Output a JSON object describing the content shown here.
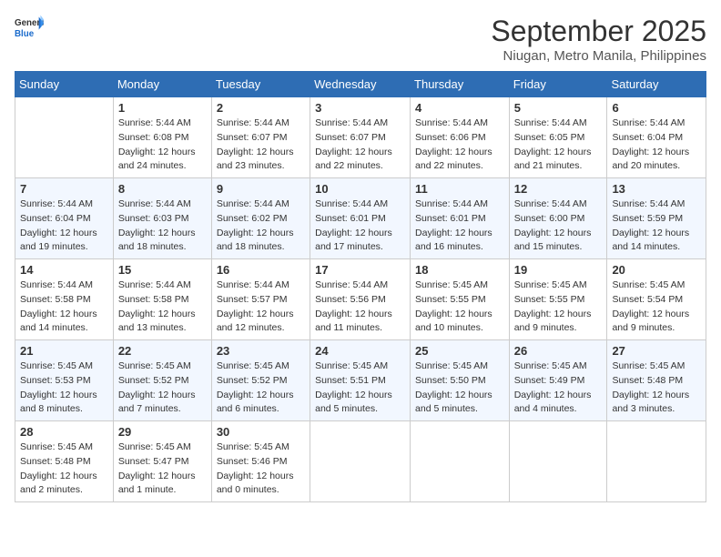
{
  "header": {
    "logo_general": "General",
    "logo_blue": "Blue",
    "month": "September 2025",
    "location": "Niugan, Metro Manila, Philippines"
  },
  "days_of_week": [
    "Sunday",
    "Monday",
    "Tuesday",
    "Wednesday",
    "Thursday",
    "Friday",
    "Saturday"
  ],
  "weeks": [
    [
      {
        "day": "",
        "sunrise": "",
        "sunset": "",
        "daylight": ""
      },
      {
        "day": "1",
        "sunrise": "Sunrise: 5:44 AM",
        "sunset": "Sunset: 6:08 PM",
        "daylight": "Daylight: 12 hours and 24 minutes."
      },
      {
        "day": "2",
        "sunrise": "Sunrise: 5:44 AM",
        "sunset": "Sunset: 6:07 PM",
        "daylight": "Daylight: 12 hours and 23 minutes."
      },
      {
        "day": "3",
        "sunrise": "Sunrise: 5:44 AM",
        "sunset": "Sunset: 6:07 PM",
        "daylight": "Daylight: 12 hours and 22 minutes."
      },
      {
        "day": "4",
        "sunrise": "Sunrise: 5:44 AM",
        "sunset": "Sunset: 6:06 PM",
        "daylight": "Daylight: 12 hours and 22 minutes."
      },
      {
        "day": "5",
        "sunrise": "Sunrise: 5:44 AM",
        "sunset": "Sunset: 6:05 PM",
        "daylight": "Daylight: 12 hours and 21 minutes."
      },
      {
        "day": "6",
        "sunrise": "Sunrise: 5:44 AM",
        "sunset": "Sunset: 6:04 PM",
        "daylight": "Daylight: 12 hours and 20 minutes."
      }
    ],
    [
      {
        "day": "7",
        "sunrise": "Sunrise: 5:44 AM",
        "sunset": "Sunset: 6:04 PM",
        "daylight": "Daylight: 12 hours and 19 minutes."
      },
      {
        "day": "8",
        "sunrise": "Sunrise: 5:44 AM",
        "sunset": "Sunset: 6:03 PM",
        "daylight": "Daylight: 12 hours and 18 minutes."
      },
      {
        "day": "9",
        "sunrise": "Sunrise: 5:44 AM",
        "sunset": "Sunset: 6:02 PM",
        "daylight": "Daylight: 12 hours and 18 minutes."
      },
      {
        "day": "10",
        "sunrise": "Sunrise: 5:44 AM",
        "sunset": "Sunset: 6:01 PM",
        "daylight": "Daylight: 12 hours and 17 minutes."
      },
      {
        "day": "11",
        "sunrise": "Sunrise: 5:44 AM",
        "sunset": "Sunset: 6:01 PM",
        "daylight": "Daylight: 12 hours and 16 minutes."
      },
      {
        "day": "12",
        "sunrise": "Sunrise: 5:44 AM",
        "sunset": "Sunset: 6:00 PM",
        "daylight": "Daylight: 12 hours and 15 minutes."
      },
      {
        "day": "13",
        "sunrise": "Sunrise: 5:44 AM",
        "sunset": "Sunset: 5:59 PM",
        "daylight": "Daylight: 12 hours and 14 minutes."
      }
    ],
    [
      {
        "day": "14",
        "sunrise": "Sunrise: 5:44 AM",
        "sunset": "Sunset: 5:58 PM",
        "daylight": "Daylight: 12 hours and 14 minutes."
      },
      {
        "day": "15",
        "sunrise": "Sunrise: 5:44 AM",
        "sunset": "Sunset: 5:58 PM",
        "daylight": "Daylight: 12 hours and 13 minutes."
      },
      {
        "day": "16",
        "sunrise": "Sunrise: 5:44 AM",
        "sunset": "Sunset: 5:57 PM",
        "daylight": "Daylight: 12 hours and 12 minutes."
      },
      {
        "day": "17",
        "sunrise": "Sunrise: 5:44 AM",
        "sunset": "Sunset: 5:56 PM",
        "daylight": "Daylight: 12 hours and 11 minutes."
      },
      {
        "day": "18",
        "sunrise": "Sunrise: 5:45 AM",
        "sunset": "Sunset: 5:55 PM",
        "daylight": "Daylight: 12 hours and 10 minutes."
      },
      {
        "day": "19",
        "sunrise": "Sunrise: 5:45 AM",
        "sunset": "Sunset: 5:55 PM",
        "daylight": "Daylight: 12 hours and 9 minutes."
      },
      {
        "day": "20",
        "sunrise": "Sunrise: 5:45 AM",
        "sunset": "Sunset: 5:54 PM",
        "daylight": "Daylight: 12 hours and 9 minutes."
      }
    ],
    [
      {
        "day": "21",
        "sunrise": "Sunrise: 5:45 AM",
        "sunset": "Sunset: 5:53 PM",
        "daylight": "Daylight: 12 hours and 8 minutes."
      },
      {
        "day": "22",
        "sunrise": "Sunrise: 5:45 AM",
        "sunset": "Sunset: 5:52 PM",
        "daylight": "Daylight: 12 hours and 7 minutes."
      },
      {
        "day": "23",
        "sunrise": "Sunrise: 5:45 AM",
        "sunset": "Sunset: 5:52 PM",
        "daylight": "Daylight: 12 hours and 6 minutes."
      },
      {
        "day": "24",
        "sunrise": "Sunrise: 5:45 AM",
        "sunset": "Sunset: 5:51 PM",
        "daylight": "Daylight: 12 hours and 5 minutes."
      },
      {
        "day": "25",
        "sunrise": "Sunrise: 5:45 AM",
        "sunset": "Sunset: 5:50 PM",
        "daylight": "Daylight: 12 hours and 5 minutes."
      },
      {
        "day": "26",
        "sunrise": "Sunrise: 5:45 AM",
        "sunset": "Sunset: 5:49 PM",
        "daylight": "Daylight: 12 hours and 4 minutes."
      },
      {
        "day": "27",
        "sunrise": "Sunrise: 5:45 AM",
        "sunset": "Sunset: 5:48 PM",
        "daylight": "Daylight: 12 hours and 3 minutes."
      }
    ],
    [
      {
        "day": "28",
        "sunrise": "Sunrise: 5:45 AM",
        "sunset": "Sunset: 5:48 PM",
        "daylight": "Daylight: 12 hours and 2 minutes."
      },
      {
        "day": "29",
        "sunrise": "Sunrise: 5:45 AM",
        "sunset": "Sunset: 5:47 PM",
        "daylight": "Daylight: 12 hours and 1 minute."
      },
      {
        "day": "30",
        "sunrise": "Sunrise: 5:45 AM",
        "sunset": "Sunset: 5:46 PM",
        "daylight": "Daylight: 12 hours and 0 minutes."
      },
      {
        "day": "",
        "sunrise": "",
        "sunset": "",
        "daylight": ""
      },
      {
        "day": "",
        "sunrise": "",
        "sunset": "",
        "daylight": ""
      },
      {
        "day": "",
        "sunrise": "",
        "sunset": "",
        "daylight": ""
      },
      {
        "day": "",
        "sunrise": "",
        "sunset": "",
        "daylight": ""
      }
    ]
  ]
}
